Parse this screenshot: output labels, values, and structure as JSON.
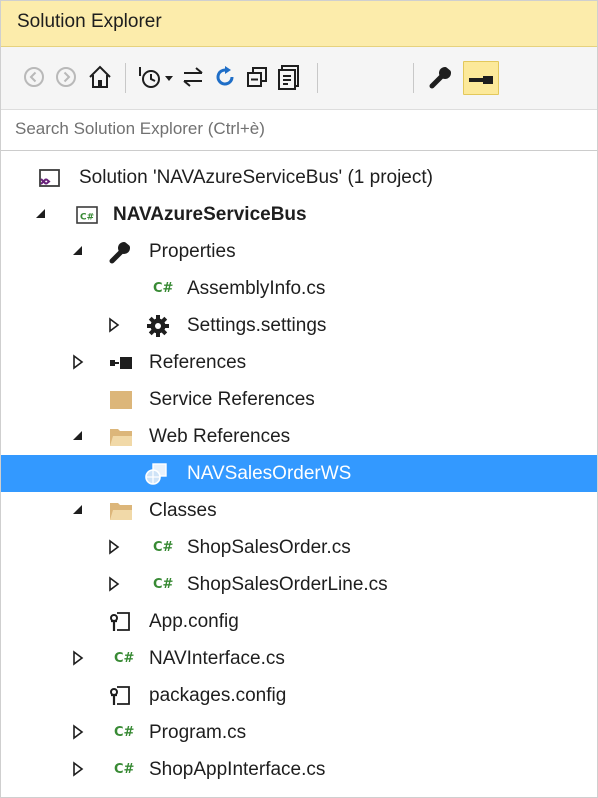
{
  "panel": {
    "title": "Solution Explorer"
  },
  "toolbar": {
    "buttons": [
      {
        "name": "back-button",
        "icon": "back-arrow-icon"
      },
      {
        "name": "forward-button",
        "icon": "forward-arrow-icon"
      },
      {
        "name": "home-button",
        "icon": "home-icon"
      },
      {
        "name": "pending-changes-filter-button",
        "icon": "clock-filter-icon"
      },
      {
        "name": "sync-with-active-document-button",
        "icon": "sync-arrows-icon"
      },
      {
        "name": "refresh-button",
        "icon": "refresh-icon"
      },
      {
        "name": "collapse-all-button",
        "icon": "collapse-all-icon"
      },
      {
        "name": "show-all-files-button",
        "icon": "show-all-files-icon"
      },
      {
        "name": "properties-button",
        "icon": "wrench-icon"
      },
      {
        "name": "preview-selected-items-button",
        "icon": "preview-icon"
      }
    ],
    "accent_color": "#fce99a"
  },
  "search": {
    "placeholder": "Search Solution Explorer (Ctrl+è)",
    "value": ""
  },
  "tree": {
    "selected_color": "#3399ff",
    "items": [
      {
        "label": "Solution 'NAVAzureServiceBus' (1 project)",
        "icon": "solution-icon",
        "expander": "none",
        "level": 0
      },
      {
        "label": "NAVAzureServiceBus",
        "icon": "csharp-project-icon",
        "expander": "expanded",
        "level": 0,
        "bold": true
      },
      {
        "label": "Properties",
        "icon": "wrench-icon",
        "expander": "expanded",
        "level": 1
      },
      {
        "label": "AssemblyInfo.cs",
        "icon": "csharp-file-icon",
        "icon_text": "C#",
        "expander": "none",
        "level": 2
      },
      {
        "label": "Settings.settings",
        "icon": "gear-icon",
        "expander": "collapsed",
        "level": 2
      },
      {
        "label": "References",
        "icon": "references-icon",
        "expander": "collapsed",
        "level": 1
      },
      {
        "label": "Service References",
        "icon": "folder-icon",
        "expander": "none",
        "level": 1
      },
      {
        "label": "Web References",
        "icon": "folder-open-icon",
        "expander": "expanded",
        "level": 1
      },
      {
        "label": "NAVSalesOrderWS",
        "icon": "web-reference-icon",
        "expander": "none",
        "level": 2,
        "selected": true
      },
      {
        "label": "Classes",
        "icon": "folder-open-icon",
        "expander": "expanded",
        "level": 1
      },
      {
        "label": "ShopSalesOrder.cs",
        "icon": "csharp-file-icon",
        "icon_text": "C#",
        "expander": "collapsed",
        "level": 2
      },
      {
        "label": "ShopSalesOrderLine.cs",
        "icon": "csharp-file-icon",
        "icon_text": "C#",
        "expander": "collapsed",
        "level": 2
      },
      {
        "label": "App.config",
        "icon": "config-file-icon",
        "expander": "none",
        "level": 1
      },
      {
        "label": "NAVInterface.cs",
        "icon": "csharp-file-icon",
        "icon_text": "C#",
        "expander": "collapsed",
        "level": 1
      },
      {
        "label": "packages.config",
        "icon": "config-file-icon",
        "expander": "none",
        "level": 1
      },
      {
        "label": "Program.cs",
        "icon": "csharp-file-icon",
        "icon_text": "C#",
        "expander": "collapsed",
        "level": 1
      },
      {
        "label": "ShopAppInterface.cs",
        "icon": "csharp-file-icon",
        "icon_text": "C#",
        "expander": "collapsed",
        "level": 1
      }
    ]
  }
}
